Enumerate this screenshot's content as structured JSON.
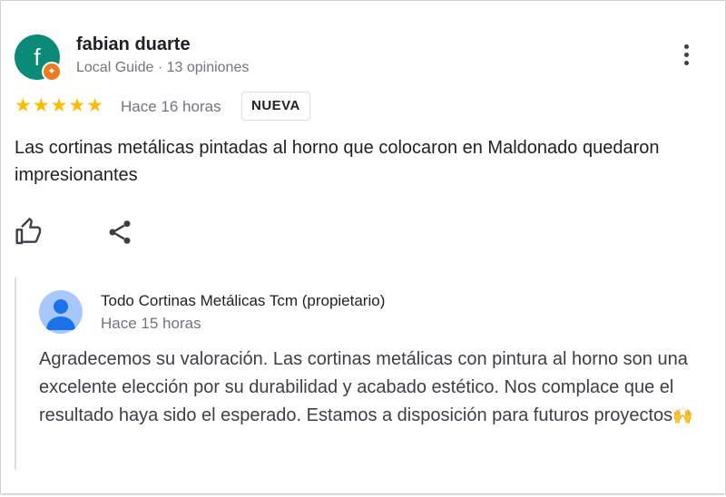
{
  "review": {
    "author_initial": "f",
    "author_name": "fabian duarte",
    "author_subtitle": "Local Guide · 13 opiniones",
    "stars": "★★★★★",
    "rating": 5,
    "time": "Hace 16 horas",
    "badge": "NUEVA",
    "text": "Las cortinas metálicas pintadas al horno que colocaron en Maldonado quedaron impresionantes"
  },
  "actions": {
    "like_icon": "thumbs-up-icon",
    "share_icon": "share-icon",
    "more_icon": "more-vert-icon"
  },
  "reply": {
    "owner_name": "Todo Cortinas Metálicas Tcm (propietario)",
    "time": "Hace 15 horas",
    "text": "Agradecemos su valoración. Las cortinas metálicas con pintura al horno son una excelente elección por su durabilidad y acabado estético. Nos complace que el resultado haya sido el esperado. Estamos a disposición para futuros proyectos",
    "emoji": "🙌"
  },
  "colors": {
    "avatar_bg": "#0b8a78",
    "guide_badge": "#ea7c22",
    "star": "#fbbc04",
    "owner_avatar": "#a8c7fa"
  }
}
